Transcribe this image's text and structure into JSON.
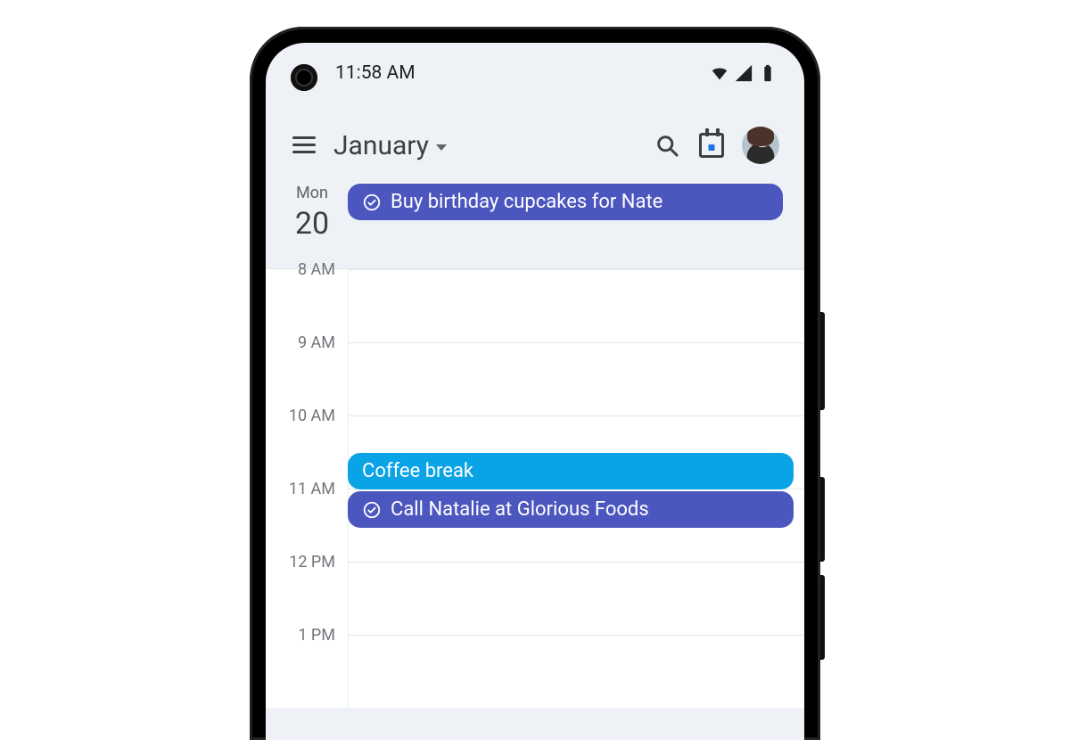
{
  "status": {
    "time": "11:58 AM"
  },
  "header": {
    "month": "January"
  },
  "day": {
    "dow": "Mon",
    "dom": "20"
  },
  "allday": {
    "task1": "Buy birthday cupcakes for Nate"
  },
  "hours": {
    "h8": "8 AM",
    "h9": "9 AM",
    "h10": "10 AM",
    "h11": "11 AM",
    "h12": "12 PM",
    "h13": "1 PM"
  },
  "events": {
    "coffee": "Coffee break",
    "call": "Call Natalie at Glorious Foods"
  }
}
